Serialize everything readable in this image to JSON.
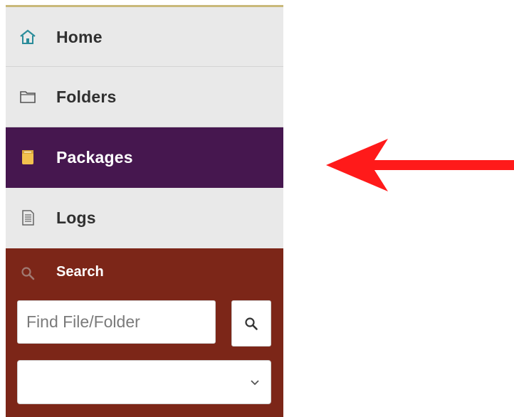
{
  "colors": {
    "sidebar_bg": "#e9e9e9",
    "active_item_bg": "#46174f",
    "search_panel_bg": "#7c2618",
    "annotation_arrow": "#ff1a1a",
    "home_icon": "#2a8c9a",
    "packages_icon": "#f2c14e"
  },
  "nav": {
    "items": [
      {
        "label": "Home",
        "icon": "home-icon",
        "active": false
      },
      {
        "label": "Folders",
        "icon": "folder-icon",
        "active": false
      },
      {
        "label": "Packages",
        "icon": "package-icon",
        "active": true
      },
      {
        "label": "Logs",
        "icon": "log-document-icon",
        "active": false
      }
    ]
  },
  "search": {
    "title": "Search",
    "icon": "search-icon",
    "input_placeholder": "Find File/Folder",
    "input_value": "",
    "button_icon": "magnifier-icon",
    "select_value": "",
    "select_icon": "chevron-down-icon"
  },
  "annotation": {
    "icon": "red-arrow-left-icon",
    "points_to": "Packages"
  }
}
